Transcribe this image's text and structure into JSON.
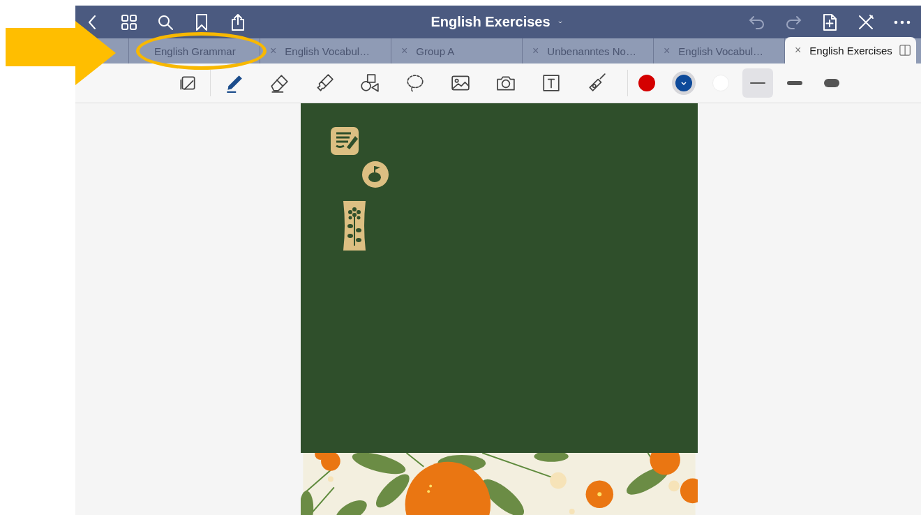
{
  "window": {
    "title": "English Exercises"
  },
  "annotation": {
    "arrow": true
  },
  "tabs": [
    {
      "label": "English Grammar",
      "selected": false,
      "highlighted": true
    },
    {
      "label": "English Vocabul…",
      "close": "×",
      "selected": false,
      "highlighted": false
    },
    {
      "label": "Group A",
      "close": "×",
      "selected": false,
      "highlighted": false
    },
    {
      "label": "Unbenanntes No…",
      "close": "×",
      "selected": false,
      "highlighted": false
    },
    {
      "label": "English Vocabul…",
      "close": "×",
      "selected": false,
      "highlighted": false
    },
    {
      "label": "English Exercises",
      "close": "×",
      "selected": true,
      "highlighted": false
    }
  ],
  "tools": [
    {
      "kind": "page",
      "selected": false
    },
    {
      "kind": "pen",
      "selected": true
    },
    {
      "kind": "eraser",
      "selected": false
    },
    {
      "kind": "highlighter",
      "selected": false
    },
    {
      "kind": "shapes",
      "selected": false
    },
    {
      "kind": "lasso",
      "selected": false
    },
    {
      "kind": "image",
      "selected": false
    },
    {
      "kind": "camera",
      "selected": false
    },
    {
      "kind": "text",
      "selected": false
    },
    {
      "kind": "laser",
      "selected": false
    }
  ],
  "colors": [
    {
      "color": "#d40000",
      "selected": false
    },
    {
      "color": "#0d4a9a",
      "selected": true
    },
    {
      "color": "#ffffff",
      "selected": false
    }
  ],
  "stroke_widths": [
    {
      "kind": "thin",
      "selected": true
    },
    {
      "kind": "medium",
      "selected": false
    },
    {
      "kind": "thick",
      "selected": false
    }
  ]
}
